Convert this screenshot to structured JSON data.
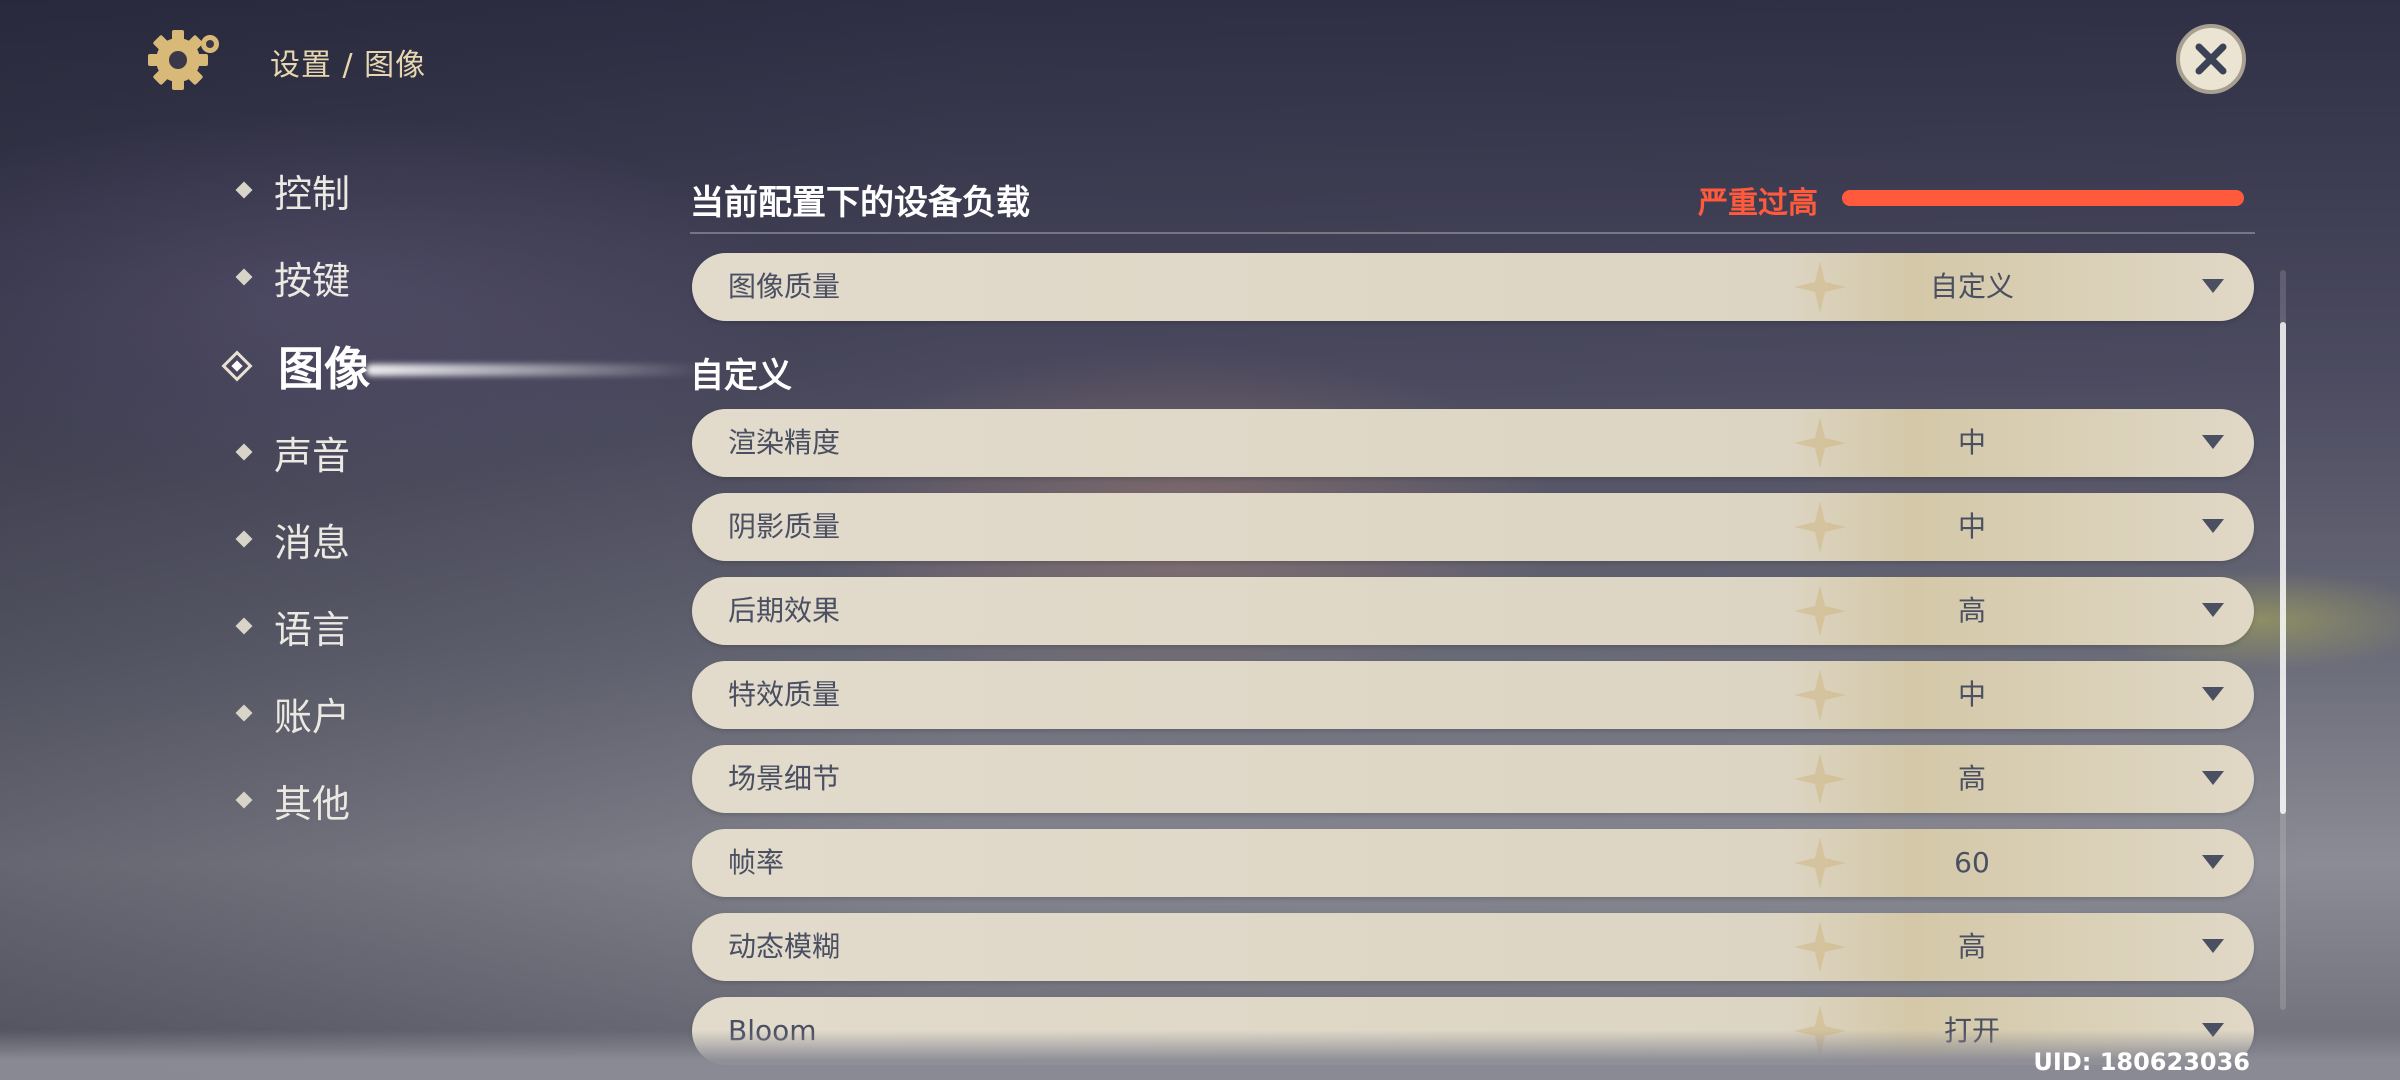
{
  "header": {
    "breadcrumb": "设置 / 图像",
    "settings_icon": "gear-icon",
    "close_icon": "close-icon"
  },
  "sidebar": {
    "items": [
      {
        "label": "控制",
        "active": false
      },
      {
        "label": "按键",
        "active": false
      },
      {
        "label": "图像",
        "active": true
      },
      {
        "label": "声音",
        "active": false
      },
      {
        "label": "消息",
        "active": false
      },
      {
        "label": "语言",
        "active": false
      },
      {
        "label": "账户",
        "active": false
      },
      {
        "label": "其他",
        "active": false
      }
    ]
  },
  "device_load": {
    "title": "当前配置下的设备负载",
    "status": "严重过高",
    "status_color": "#ff5a3c",
    "level": 1.0
  },
  "quality_preset": {
    "label": "图像质量",
    "value": "自定义"
  },
  "custom_section_title": "自定义",
  "settings": [
    {
      "label": "渲染精度",
      "value": "中"
    },
    {
      "label": "阴影质量",
      "value": "中"
    },
    {
      "label": "后期效果",
      "value": "高"
    },
    {
      "label": "特效质量",
      "value": "中"
    },
    {
      "label": "场景细节",
      "value": "高"
    },
    {
      "label": "帧率",
      "value": "60"
    },
    {
      "label": "动态模糊",
      "value": "高"
    },
    {
      "label": "Bloom",
      "value": "打开"
    }
  ],
  "footer": {
    "uid": "UID: 180623036"
  }
}
